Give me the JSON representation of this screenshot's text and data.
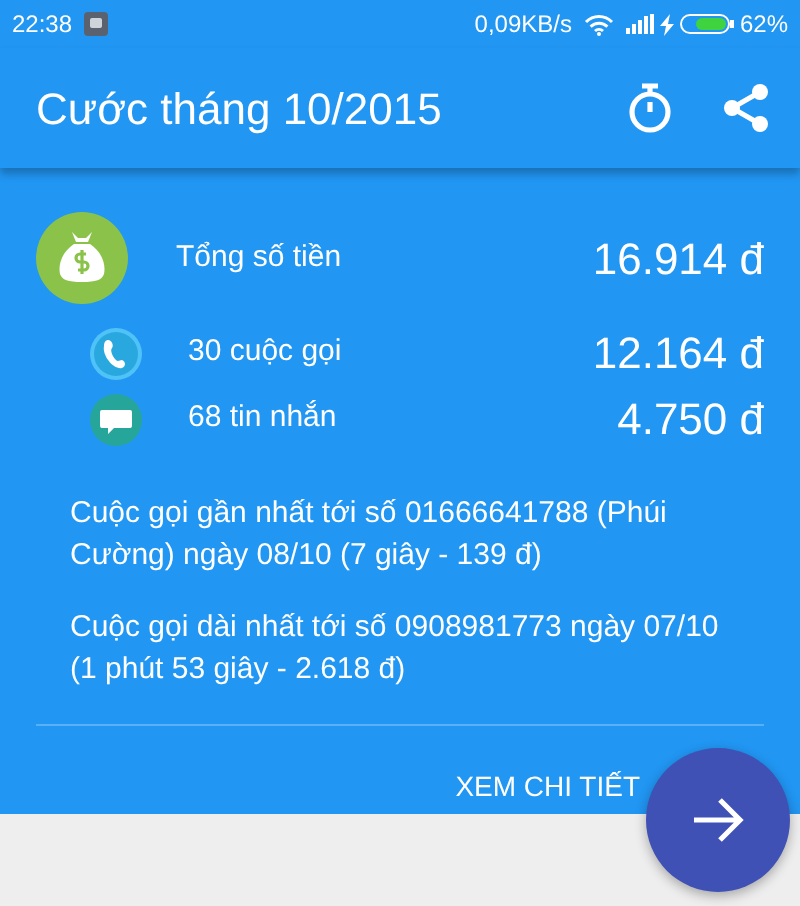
{
  "status_bar": {
    "time": "22:38",
    "speed": "0,09KB/s",
    "battery": "62%"
  },
  "app_bar": {
    "title": "Cước tháng 10/2015"
  },
  "summary": [
    {
      "kind": "total",
      "label": "Tổng số tiền",
      "amount": "16.914 đ"
    },
    {
      "kind": "calls",
      "label": "30 cuộc gọi",
      "amount": "12.164 đ"
    },
    {
      "kind": "sms",
      "label": "68 tin nhắn",
      "amount": "4.750 đ"
    }
  ],
  "notes": [
    "Cuộc gọi gần nhất tới số 01666641788 (Phúi Cường) ngày 08/10 (7 giây - 139 đ)",
    "Cuộc gọi dài nhất tới số 0908981773 ngày 07/10 (1 phút 53 giây - 2.618 đ)"
  ],
  "details_link": "XEM CHI TIẾT"
}
